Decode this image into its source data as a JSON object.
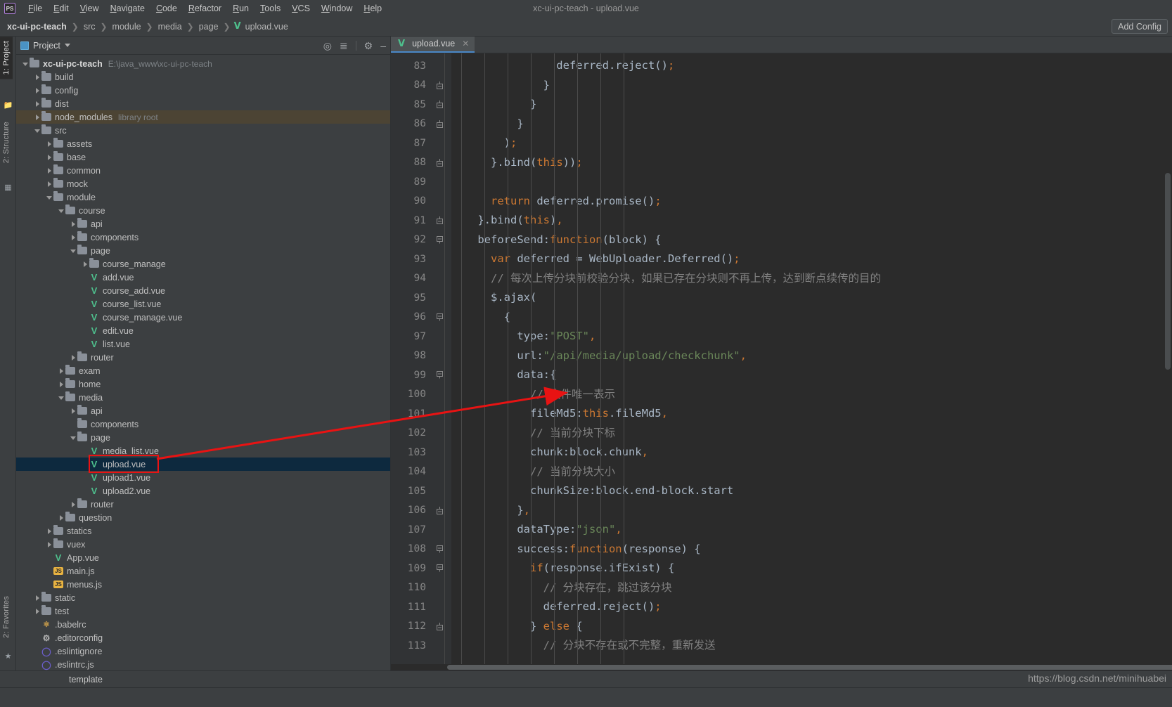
{
  "window": {
    "title": "xc-ui-pc-teach - upload.vue",
    "logo_text": "PS"
  },
  "menubar": {
    "items": [
      {
        "label": "File"
      },
      {
        "label": "Edit"
      },
      {
        "label": "View"
      },
      {
        "label": "Navigate"
      },
      {
        "label": "Code"
      },
      {
        "label": "Refactor"
      },
      {
        "label": "Run"
      },
      {
        "label": "Tools"
      },
      {
        "label": "VCS"
      },
      {
        "label": "Window"
      },
      {
        "label": "Help"
      }
    ]
  },
  "navbar": {
    "crumbs": [
      "xc-ui-pc-teach",
      "src",
      "module",
      "media",
      "page"
    ],
    "file": "upload.vue",
    "file_icon": "vue-file-icon",
    "add_config_label": "Add Config"
  },
  "toolstrip": {
    "tabs": [
      {
        "label": "1: Project",
        "active": true
      },
      {
        "label": "2: Structure",
        "active": false
      }
    ],
    "bottom_tab": {
      "label": "2: Favorites"
    }
  },
  "project_panel": {
    "title": "Project",
    "icons": [
      "locate-target-icon",
      "collapse-all-icon",
      "gear-icon",
      "minimize-icon"
    ],
    "tree": [
      {
        "depth": 0,
        "label": "xc-ui-pc-teach",
        "sub": "E:\\java_www\\xc-ui-pc-teach",
        "type": "folder",
        "state": "open",
        "bold": true
      },
      {
        "depth": 1,
        "label": "build",
        "type": "folder",
        "state": "closed"
      },
      {
        "depth": 1,
        "label": "config",
        "type": "folder",
        "state": "closed"
      },
      {
        "depth": 1,
        "label": "dist",
        "type": "folder",
        "state": "closed"
      },
      {
        "depth": 1,
        "label": "node_modules",
        "sub": "library root",
        "type": "folder",
        "state": "closed",
        "highlight": "library-root"
      },
      {
        "depth": 1,
        "label": "src",
        "type": "folder",
        "state": "open"
      },
      {
        "depth": 2,
        "label": "assets",
        "type": "folder",
        "state": "closed"
      },
      {
        "depth": 2,
        "label": "base",
        "type": "folder",
        "state": "closed"
      },
      {
        "depth": 2,
        "label": "common",
        "type": "folder",
        "state": "closed"
      },
      {
        "depth": 2,
        "label": "mock",
        "type": "folder",
        "state": "closed"
      },
      {
        "depth": 2,
        "label": "module",
        "type": "folder",
        "state": "open"
      },
      {
        "depth": 3,
        "label": "course",
        "type": "folder",
        "state": "open"
      },
      {
        "depth": 4,
        "label": "api",
        "type": "folder",
        "state": "closed"
      },
      {
        "depth": 4,
        "label": "components",
        "type": "folder",
        "state": "closed"
      },
      {
        "depth": 4,
        "label": "page",
        "type": "folder",
        "state": "open"
      },
      {
        "depth": 5,
        "label": "course_manage",
        "type": "folder",
        "state": "closed"
      },
      {
        "depth": 5,
        "label": "add.vue",
        "type": "vue"
      },
      {
        "depth": 5,
        "label": "course_add.vue",
        "type": "vue"
      },
      {
        "depth": 5,
        "label": "course_list.vue",
        "type": "vue"
      },
      {
        "depth": 5,
        "label": "course_manage.vue",
        "type": "vue"
      },
      {
        "depth": 5,
        "label": "edit.vue",
        "type": "vue"
      },
      {
        "depth": 5,
        "label": "list.vue",
        "type": "vue"
      },
      {
        "depth": 4,
        "label": "router",
        "type": "folder",
        "state": "closed"
      },
      {
        "depth": 3,
        "label": "exam",
        "type": "folder",
        "state": "closed"
      },
      {
        "depth": 3,
        "label": "home",
        "type": "folder",
        "state": "closed"
      },
      {
        "depth": 3,
        "label": "media",
        "type": "folder",
        "state": "open"
      },
      {
        "depth": 4,
        "label": "api",
        "type": "folder",
        "state": "closed"
      },
      {
        "depth": 4,
        "label": "components",
        "type": "folder",
        "state": "none"
      },
      {
        "depth": 4,
        "label": "page",
        "type": "folder",
        "state": "open"
      },
      {
        "depth": 5,
        "label": "media_list.vue",
        "type": "vue"
      },
      {
        "depth": 5,
        "label": "upload.vue",
        "type": "vue",
        "selected": true,
        "boxed": true
      },
      {
        "depth": 5,
        "label": "upload1.vue",
        "type": "vue"
      },
      {
        "depth": 5,
        "label": "upload2.vue",
        "type": "vue"
      },
      {
        "depth": 4,
        "label": "router",
        "type": "folder",
        "state": "closed"
      },
      {
        "depth": 3,
        "label": "question",
        "type": "folder",
        "state": "closed"
      },
      {
        "depth": 2,
        "label": "statics",
        "type": "folder",
        "state": "closed"
      },
      {
        "depth": 2,
        "label": "vuex",
        "type": "folder",
        "state": "closed"
      },
      {
        "depth": 2,
        "label": "App.vue",
        "type": "vue"
      },
      {
        "depth": 2,
        "label": "main.js",
        "type": "js"
      },
      {
        "depth": 2,
        "label": "menus.js",
        "type": "js"
      },
      {
        "depth": 1,
        "label": "static",
        "type": "folder",
        "state": "closed"
      },
      {
        "depth": 1,
        "label": "test",
        "type": "folder",
        "state": "closed"
      },
      {
        "depth": 1,
        "label": ".babelrc",
        "type": "babel"
      },
      {
        "depth": 1,
        "label": ".editorconfig",
        "type": "gear"
      },
      {
        "depth": 1,
        "label": ".eslintignore",
        "type": "circle"
      },
      {
        "depth": 1,
        "label": ".eslintrc.js",
        "type": "circle"
      }
    ]
  },
  "editor": {
    "tab": {
      "label": "upload.vue",
      "icon": "vue-file-icon",
      "close_icon": "close-icon"
    },
    "first_line_number": 83,
    "lines": [
      {
        "n": 83,
        "fold": "none",
        "text": "                deferred.reject();"
      },
      {
        "n": 84,
        "fold": "end",
        "text": "              }"
      },
      {
        "n": 85,
        "fold": "end",
        "text": "            }"
      },
      {
        "n": 86,
        "fold": "end",
        "text": "          }"
      },
      {
        "n": 87,
        "fold": "none",
        "text": "        );"
      },
      {
        "n": 88,
        "fold": "end",
        "text": "      }.bind(this));"
      },
      {
        "n": 89,
        "fold": "none",
        "text": ""
      },
      {
        "n": 90,
        "fold": "none",
        "text": "      return deferred.promise();"
      },
      {
        "n": 91,
        "fold": "end",
        "text": "    }.bind(this),"
      },
      {
        "n": 92,
        "fold": "start",
        "text": "    beforeSend:function(block) {"
      },
      {
        "n": 93,
        "fold": "none",
        "text": "      var deferred = WebUploader.Deferred();"
      },
      {
        "n": 94,
        "fold": "none",
        "text": "      // 每次上传分块前校验分块，如果已存在分块则不再上传，达到断点续传的目的"
      },
      {
        "n": 95,
        "fold": "none",
        "text": "      $.ajax("
      },
      {
        "n": 96,
        "fold": "start",
        "text": "        {"
      },
      {
        "n": 97,
        "fold": "none",
        "text": "          type:\"POST\","
      },
      {
        "n": 98,
        "fold": "none",
        "text": "          url:\"/api/media/upload/checkchunk\","
      },
      {
        "n": 99,
        "fold": "start",
        "text": "          data:{"
      },
      {
        "n": 100,
        "fold": "none",
        "text": "            // 文件唯一表示"
      },
      {
        "n": 101,
        "fold": "none",
        "text": "            fileMd5:this.fileMd5,"
      },
      {
        "n": 102,
        "fold": "none",
        "text": "            // 当前分块下标"
      },
      {
        "n": 103,
        "fold": "none",
        "text": "            chunk:block.chunk,"
      },
      {
        "n": 104,
        "fold": "none",
        "text": "            // 当前分块大小"
      },
      {
        "n": 105,
        "fold": "none",
        "text": "            chunkSize:block.end-block.start"
      },
      {
        "n": 106,
        "fold": "end",
        "text": "          },"
      },
      {
        "n": 107,
        "fold": "none",
        "text": "          dataType:\"json\","
      },
      {
        "n": 108,
        "fold": "start",
        "text": "          success:function(response) {"
      },
      {
        "n": 109,
        "fold": "start",
        "text": "            if(response.ifExist) {"
      },
      {
        "n": 110,
        "fold": "none",
        "text": "              // 分块存在，跳过该分块"
      },
      {
        "n": 111,
        "fold": "none",
        "text": "              deferred.reject();"
      },
      {
        "n": 112,
        "fold": "end",
        "text": "            } else {"
      },
      {
        "n": 113,
        "fold": "none",
        "text": "              // 分块不存在或不完整，重新发送"
      }
    ]
  },
  "status": {
    "breadcrumb": "template",
    "watermark": "https://blog.csdn.net/minihuabei"
  },
  "annotation": {
    "arrow_color": "#e81313",
    "box_color": "#e81313"
  }
}
